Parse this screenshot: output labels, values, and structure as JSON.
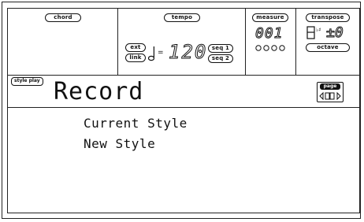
{
  "header": {
    "chord_label": "chord",
    "tempo_label": "tempo",
    "ext_label": "ext",
    "link_label": "link",
    "tempo_value": "120",
    "seq1_label": "seq 1",
    "seq2_label": "seq 2",
    "measure_label": "measure",
    "measure_value": "001",
    "transpose_label": "transpose",
    "transpose_value": "±0",
    "octave_label": "octave"
  },
  "titlebar": {
    "section_tag": "style play",
    "title": "Record",
    "page_label": "page"
  },
  "menu": {
    "items": [
      "Current Style",
      "New Style"
    ]
  }
}
